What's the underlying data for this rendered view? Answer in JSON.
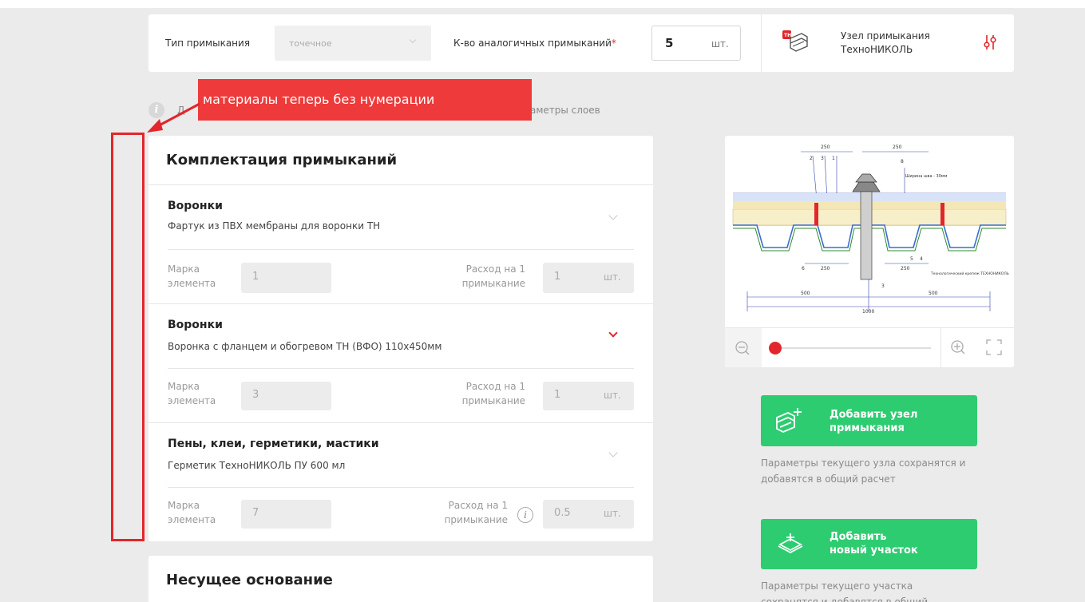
{
  "topbar": {
    "type_label": "Тип примыкания",
    "type_value": "точечное",
    "count_label": "К-во аналогичных примыканий",
    "count_required_mark": "*",
    "count_value": "5",
    "count_unit": "шт.",
    "node_logo_text": "ТН",
    "node_label": "Узел примыкания ТехноНИКОЛЬ"
  },
  "annotation": {
    "text": "материалы теперь без нумерации",
    "info_text_left": "Д",
    "info_text_right": "аметры слоев",
    "color": "#ee3a3a"
  },
  "main": {
    "title": "Комплектация примыканий",
    "items": [
      {
        "category": "Воронки",
        "name": "Фартук из ПВХ мембраны для воронки ТН",
        "mark_label": "Марка элемента",
        "mark_value": "1",
        "usage_label": "Расход на 1 примыкание",
        "usage_value": "1",
        "unit": "шт.",
        "expanded": false
      },
      {
        "category": "Воронки",
        "name": "Воронка с фланцем и обогревом ТН (ВФО) 110х450мм",
        "mark_label": "Марка элемента",
        "mark_value": "3",
        "usage_label": "Расход на 1 примыкание",
        "usage_value": "1",
        "unit": "шт.",
        "expanded": true
      },
      {
        "category": "Пены, клеи, герметики, мастики",
        "name": "Герметик ТехноНИКОЛЬ ПУ 600 мл",
        "mark_label": "Марка элемента",
        "mark_value": "7",
        "usage_label": "Расход на 1 примыкание",
        "usage_value": "0.5",
        "unit": "шт.",
        "has_info": true
      }
    ],
    "second_title": "Несущее основание"
  },
  "drawing": {
    "dims": [
      "250",
      "250",
      "250",
      "250",
      "500",
      "500",
      "1000"
    ],
    "notes": [
      "Ширина шва - 30мм",
      "Технологический крепеж ТЕХНОНИКОЛЬ"
    ],
    "callouts": [
      "2",
      "3",
      "1",
      "8",
      "6",
      "5",
      "4",
      "3"
    ],
    "zoom_level": 0.0
  },
  "actions": {
    "add_node_label_1": "Добавить узел",
    "add_node_label_2": "примыкания",
    "add_node_note": "Параметры текущего узла сохранятся и добавятся в общий расчет",
    "add_section_label_1": "Добавить",
    "add_section_label_2": "новый участок",
    "add_section_note": "Параметры текущего участка сохранятся и добавятся в общий"
  }
}
